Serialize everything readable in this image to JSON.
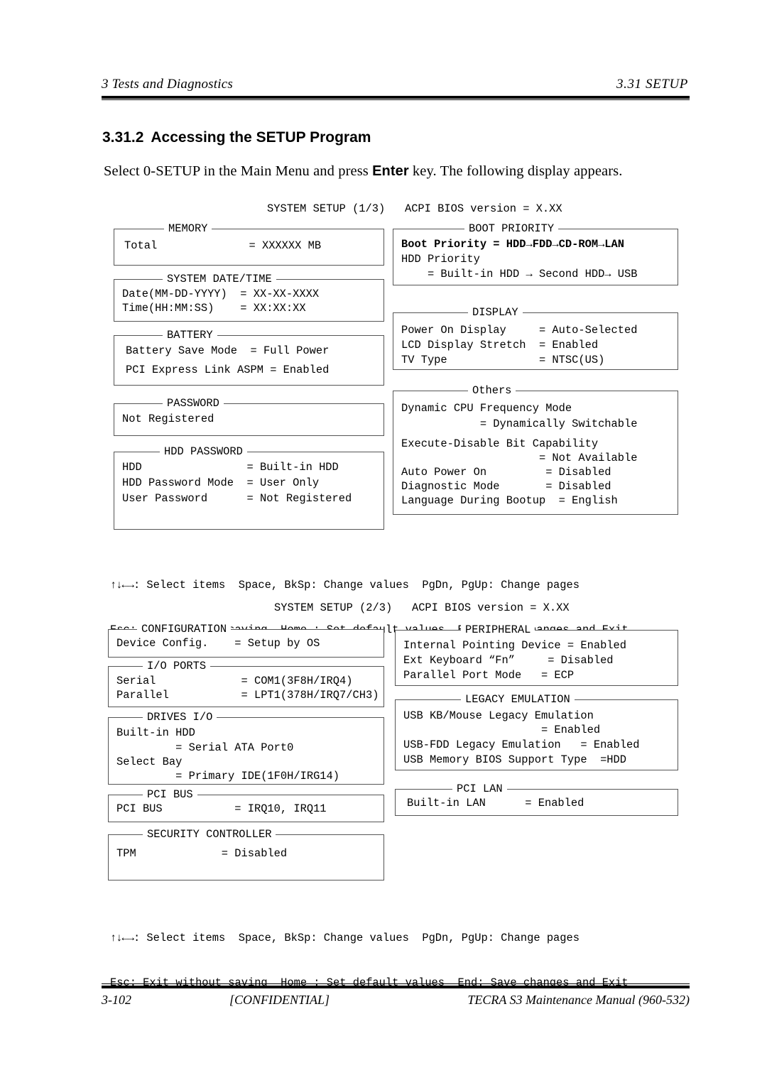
{
  "running_head": {
    "left": "3 Tests and Diagnostics",
    "right": "3.31  SETUP"
  },
  "section": {
    "number": "3.31.2",
    "title": "Accessing the SETUP Program",
    "intro_before": "Select 0-SETUP in the Main Menu and press ",
    "intro_key": "Enter",
    "intro_after": " key. The following display appears."
  },
  "screen1": {
    "title": "SYSTEM SETUP (1/3)   ACPI BIOS version = X.XX",
    "boxes": {
      "memory": {
        "legend": "MEMORY",
        "rows": [
          "Total              = XXXXXX MB"
        ]
      },
      "system_date_time": {
        "legend": "SYSTEM DATE/TIME",
        "rows": [
          "Date(MM-DD-YYYY)  = XX-XX-XXXX",
          "Time(HH:MM:SS)    = XX:XX:XX"
        ]
      },
      "battery": {
        "legend": "BATTERY",
        "rows": [
          "Battery Save Mode  = Full Power",
          "PCI Express Link ASPM = Enabled"
        ]
      },
      "password": {
        "legend": "PASSWORD",
        "rows": [
          "Not Registered"
        ]
      },
      "hdd_password": {
        "legend": "HDD PASSWORD",
        "rows": [
          "HDD                = Built-in HDD",
          "HDD Password Mode  = User Only",
          "User Password      = Not Registered"
        ]
      },
      "boot_priority": {
        "legend": "BOOT PRIORITY",
        "row_bold": "Boot Priority = HDD→FDD→CD-ROM→LAN",
        "rows": [
          "HDD Priority",
          "    = Built-in HDD → Second HDD→ USB"
        ]
      },
      "display": {
        "legend": "DISPLAY",
        "rows": [
          "Power On Display     = Auto-Selected",
          "LCD Display Stretch  = Enabled",
          "TV Type              = NTSC(US)"
        ]
      },
      "others": {
        "legend": "Others",
        "rows": [
          "Dynamic CPU Frequency Mode",
          "            = Dynamically Switchable",
          "Execute-Disable Bit Capability",
          "                     = Not Available",
          "Auto Power On         = Disabled",
          "Diagnostic Mode       = Disabled",
          "Language During Bootup  = English"
        ]
      }
    },
    "help": {
      "arrows": "↑↓←→",
      "line1": ": Select items  Space, BkSp: Change values  PgDn, PgUp: Change pages",
      "line2": "Esc: Exit without saving  Home : Set default values  End: Save changes and Exit"
    }
  },
  "screen2": {
    "title": "SYSTEM SETUP (2/3)   ACPI BIOS version = X.XX",
    "boxes": {
      "configuration": {
        "legend": "CONFIGURATION",
        "rows": [
          "Device Config.    = Setup by OS"
        ]
      },
      "io_ports": {
        "legend": "I/O PORTS",
        "rows": [
          "Serial             = COM1(3F8H/IRQ4)",
          "Parallel           = LPT1(378H/IRQ7/CH3)"
        ]
      },
      "drives_io": {
        "legend": "DRIVES I/O",
        "rows": [
          "Built-in HDD",
          "         = Serial ATA Port0",
          "Select Bay",
          "         = Primary IDE(1F0H/IRG14)"
        ]
      },
      "pci_bus": {
        "legend": "PCI BUS",
        "rows": [
          "PCI BUS           = IRQ10, IRQ11"
        ]
      },
      "security_controller": {
        "legend": "SECURITY CONTROLLER",
        "rows": [
          "TPM             = Disabled"
        ]
      },
      "peripheral": {
        "legend": "PERIPHERAL",
        "rows": [
          "Internal Pointing Device = Enabled",
          "Ext Keyboard “Fn”     = Disabled",
          "Parallel Port Mode   = ECP"
        ]
      },
      "legacy_emulation": {
        "legend": "LEGACY EMULATION",
        "rows": [
          "USB KB/Mouse Legacy Emulation",
          "                     = Enabled",
          "USB-FDD Legacy Emulation   = Enabled",
          "USB Memory BIOS Support Type  =HDD"
        ]
      },
      "pci_lan": {
        "legend": "PCI LAN",
        "rows": [
          "Built-in LAN      = Enabled"
        ]
      }
    },
    "help": {
      "arrows": "↑↓←→",
      "line1": ": Select items  Space, BkSp: Change values  PgDn, PgUp: Change pages",
      "line2": "Esc: Exit without saving  Home : Set default values  End: Save changes and Exit"
    }
  },
  "footer": {
    "page": "3-102",
    "center": "[CONFIDENTIAL]",
    "right": "TECRA S3 Maintenance Manual (960-532)"
  }
}
